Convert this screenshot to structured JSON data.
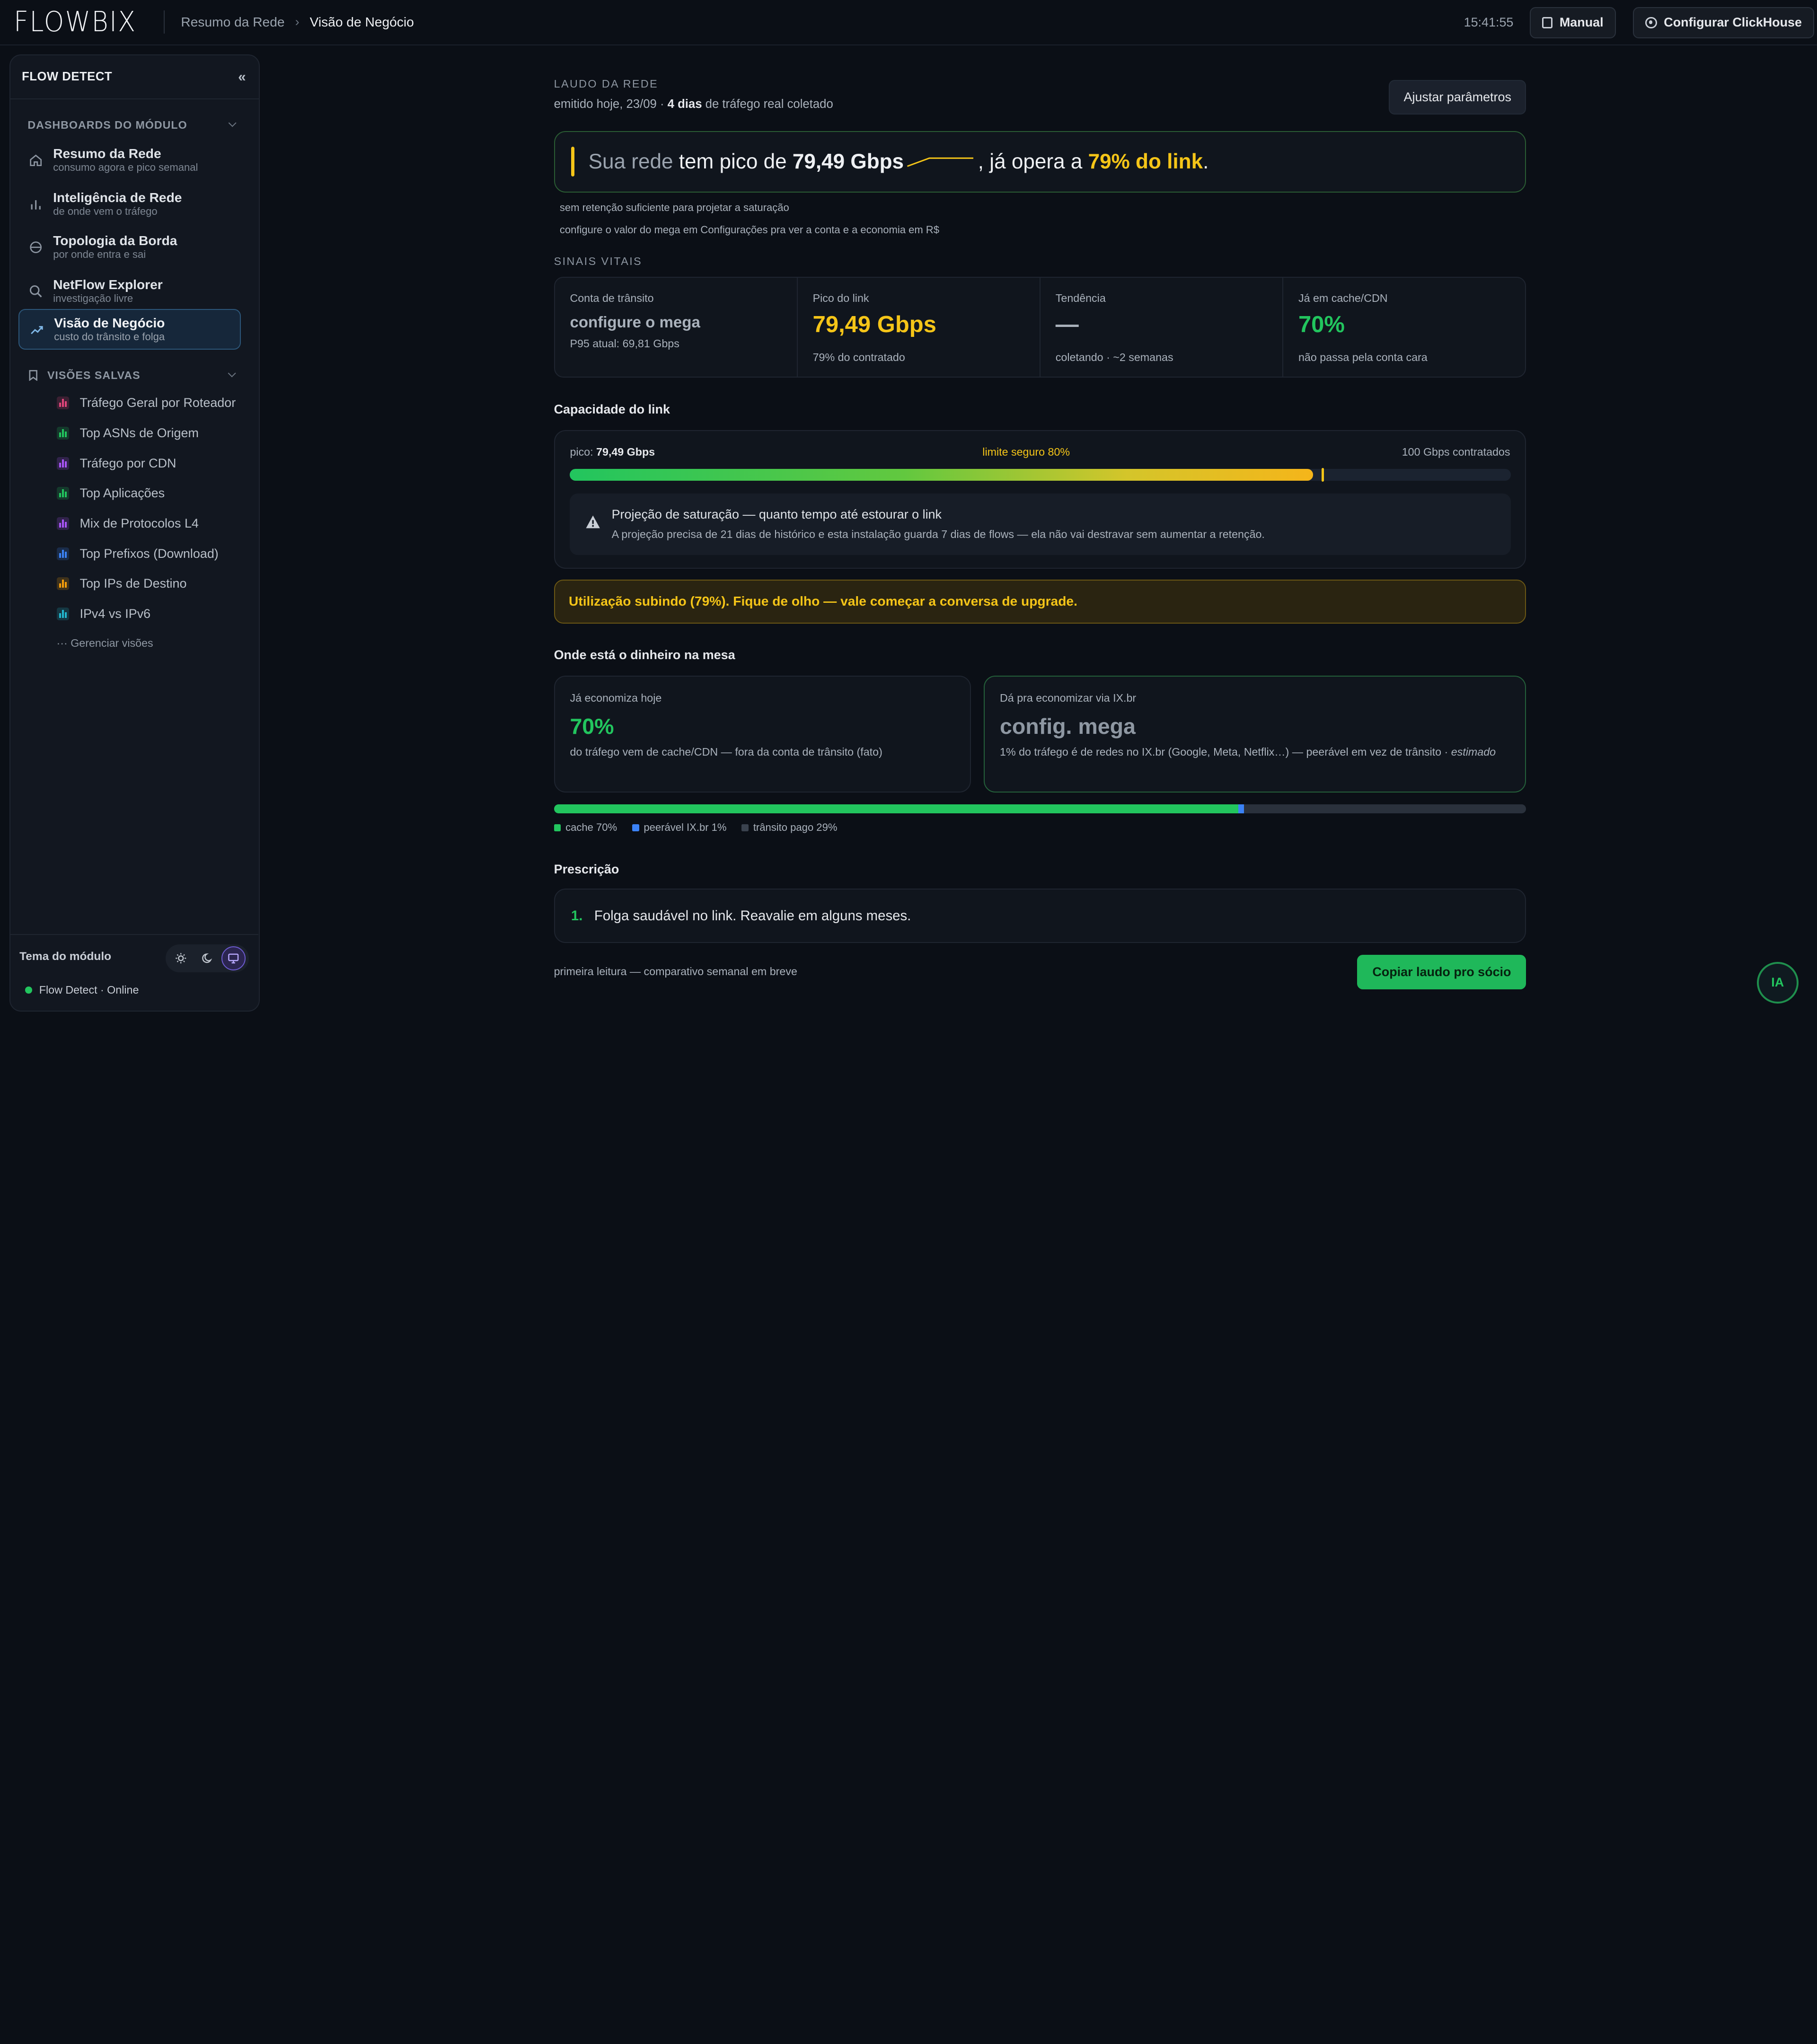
{
  "topbar": {
    "logo": "FLOWBIX",
    "breadcrumb_root": "Resumo da Rede",
    "breadcrumb_sep": "›",
    "breadcrumb_current": "Visão de Negócio",
    "clock": "15:41:55",
    "manual_label": "Manual",
    "clickhouse_label": "Configurar ClickHouse"
  },
  "sidebar": {
    "title": "FLOW DETECT",
    "collapse": "«",
    "dashboards_header": "DASHBOARDS DO MÓDULO",
    "items": [
      {
        "label": "Resumo da Rede",
        "sub": "consumo agora e pico semanal",
        "icon": "home-icon"
      },
      {
        "label": "Inteligência de Rede",
        "sub": "de onde vem o tráfego",
        "icon": "bar-chart-icon"
      },
      {
        "label": "Topologia da Borda",
        "sub": "por onde entra e sai",
        "icon": "globe-icon"
      },
      {
        "label": "NetFlow Explorer",
        "sub": "investigação livre",
        "icon": "search-icon"
      },
      {
        "label": "Visão de Negócio",
        "sub": "custo do trânsito e folga",
        "icon": "trend-icon",
        "active": true
      }
    ],
    "saved_header": "VISÕES SALVAS",
    "saved": [
      {
        "label": "Tráfego Geral por Roteador",
        "color": "#e0457b"
      },
      {
        "label": "Top ASNs de Origem",
        "color": "#22c55e"
      },
      {
        "label": "Tráfego por CDN",
        "color": "#a855f7"
      },
      {
        "label": "Top Aplicações",
        "color": "#22c55e"
      },
      {
        "label": "Mix de Protocolos L4",
        "color": "#a855f7"
      },
      {
        "label": "Top Prefixos (Download)",
        "color": "#3b82f6"
      },
      {
        "label": "Top IPs de Destino",
        "color": "#f59e0b"
      },
      {
        "label": "IPv4 vs IPv6",
        "color": "#22b8cf"
      }
    ],
    "manage": "··· Gerenciar visões",
    "theme_label": "Tema do módulo",
    "theme_options": [
      "sun-icon",
      "moon-icon",
      "monitor-icon"
    ],
    "status": "Flow Detect · Online"
  },
  "report": {
    "eyebrow": "LAUDO DA REDE",
    "emitted_prefix": "emitido hoje, 23/09 · ",
    "emitted_days": "4 dias",
    "emitted_suffix": " de tráfego real coletado",
    "adjust_label": "Ajustar parâmetros",
    "hero": {
      "p1": "Sua rede",
      "p2": " tem pico de ",
      "peak": "79,49 Gbps",
      "p3": ", já opera a ",
      "pct": "79% do link",
      "p4": "."
    },
    "note1": "sem retenção suficiente para projetar a saturação",
    "note2": "configure o valor do mega em Configurações pra ver a conta e a economia em R$",
    "vitals_title": "SINAIS VITAIS",
    "vitals": [
      {
        "label": "Conta de trânsito",
        "value": "configure o mega",
        "sub": "P95 atual: 69,81 Gbps",
        "color": "#aab2bc"
      },
      {
        "label": "Pico do link",
        "value": "79,49 Gbps",
        "sub": "79% do contratado",
        "color": "#f5c518"
      },
      {
        "label": "Tendência",
        "value": "—",
        "sub": "coletando · ~2 semanas",
        "color": "#aab2bc"
      },
      {
        "label": "Já em cache/CDN",
        "value": "70%",
        "sub": "não passa pela conta cara",
        "color": "#22c55e"
      }
    ],
    "capacity": {
      "title": "Capacidade do link",
      "peak_prefix": "pico: ",
      "peak_value": "79,49 Gbps",
      "limit": "limite seguro 80%",
      "contract": "100 Gbps contratados",
      "utilization_pct": 79,
      "safe_limit_pct": 80,
      "projection_title": "Projeção de saturação — quanto tempo até estourar o link",
      "projection_text": "A projeção precisa de 21 dias de histórico e esta instalação guarda 7 dias de flows — ela não vai destravar sem aumentar a retenção."
    },
    "alert": "Utilização subindo (79%). Fique de olho — vale começar a conversa de upgrade.",
    "money": {
      "title": "Onde está o dinheiro na mesa",
      "cards": [
        {
          "label": "Já economiza hoje",
          "value": "70%",
          "desc": "do tráfego vem de cache/CDN — fora da conta de trânsito (fato)",
          "desc_em": ""
        },
        {
          "label": "Dá pra economizar via IX.br",
          "value": "config. mega",
          "desc": "1% do tráfego é de redes no IX.br (Google, Meta, Netflix…) — peerável em vez de trânsito · ",
          "desc_em": "estimado"
        }
      ],
      "mix": [
        {
          "label": "cache 70%",
          "pct": 70.4,
          "color": "#22c55e"
        },
        {
          "label": "peerável IX.br 1%",
          "pct": 0.6,
          "color": "#3b82f6"
        },
        {
          "label": "trânsito pago 29%",
          "pct": 29,
          "color": "#2a313c"
        }
      ]
    },
    "prescription": {
      "title": "Prescrição",
      "number": "1.",
      "text": "Folga saudável no link. Reavalie em alguns meses."
    },
    "footnote": "primeira leitura — comparativo semanal em breve",
    "copy_label": "Copiar laudo pro sócio"
  },
  "assistant": {
    "label": "IA"
  }
}
